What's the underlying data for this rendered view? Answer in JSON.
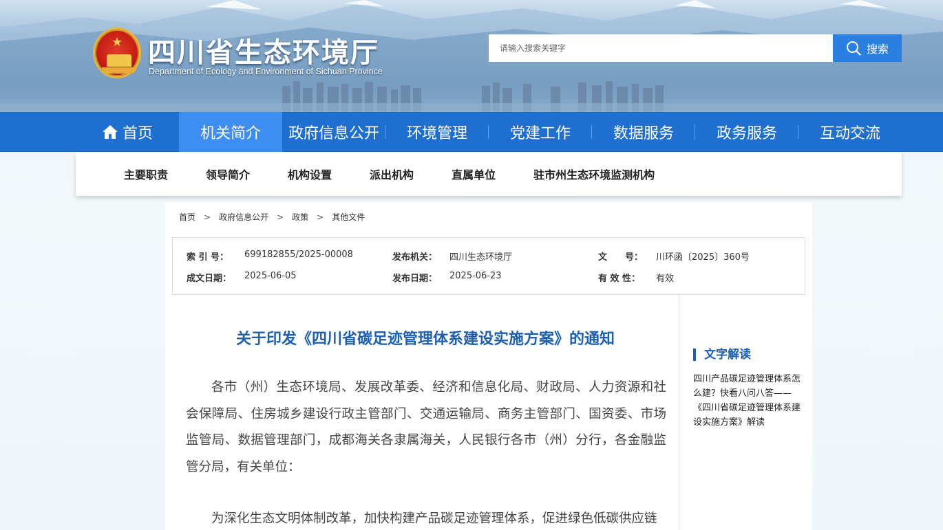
{
  "header": {
    "title": "四川省生态环境厅",
    "subtitle": "Department of Ecology and Environment of Sichuan Province",
    "search_placeholder": "请输入搜索关键字",
    "search_label": "搜索"
  },
  "mainnav": {
    "items": [
      {
        "label": "首页"
      },
      {
        "label": "机关简介"
      },
      {
        "label": "政府信息公开"
      },
      {
        "label": "环境管理"
      },
      {
        "label": "党建工作"
      },
      {
        "label": "数据服务"
      },
      {
        "label": "政务服务"
      },
      {
        "label": "互动交流"
      }
    ],
    "active_index": 1
  },
  "subnav": {
    "items": [
      "主要职责",
      "领导简介",
      "机构设置",
      "派出机构",
      "直属单位",
      "驻市州生态环境监测机构"
    ]
  },
  "breadcrumb": {
    "items": [
      "首页",
      "政府信息公开",
      "政策",
      "其他文件"
    ],
    "separator": ">"
  },
  "meta": {
    "index_label": "索 引 号：",
    "index_value": "699182855/2025-00008",
    "issuer_label": "发布机关：",
    "issuer_value": "四川生态环境厅",
    "docno_label": "文　　号：",
    "docno_value": "川环函〔2025〕360号",
    "created_label": "成文日期：",
    "created_value": "2025-06-05",
    "published_label": "发布日期：",
    "published_value": "2025-06-23",
    "validity_label": "有 效 性：",
    "validity_value": "有效"
  },
  "document": {
    "title": "关于印发《四川省碳足迹管理体系建设实施方案》的通知",
    "paragraphs": [
      "各市（州）生态环境局、发展改革委、经济和信息化局、财政局、人力资源和社会保障局、住房城乡建设行政主管部门、交通运输局、商务主管部门、国资委、市场监管局、数据管理部门，成都海关各隶属海关，人民银行各市（州）分行，各金融监管分局，有关单位：",
      "为深化生态文明体制改革，加快构建产品碳足迹管理体系，促进绿色低碳供应链"
    ]
  },
  "sidebar": {
    "heading": "文字解读",
    "link": "四川产品碳足迹管理体系怎么建？快看八问八答——《四川省碳足迹管理体系建设实施方案》解读"
  },
  "colors": {
    "nav_blue": "#1e6fd0",
    "nav_active": "#3d8ef0",
    "title_blue": "#1c5fb2",
    "search_blue": "#2a7fe0"
  }
}
